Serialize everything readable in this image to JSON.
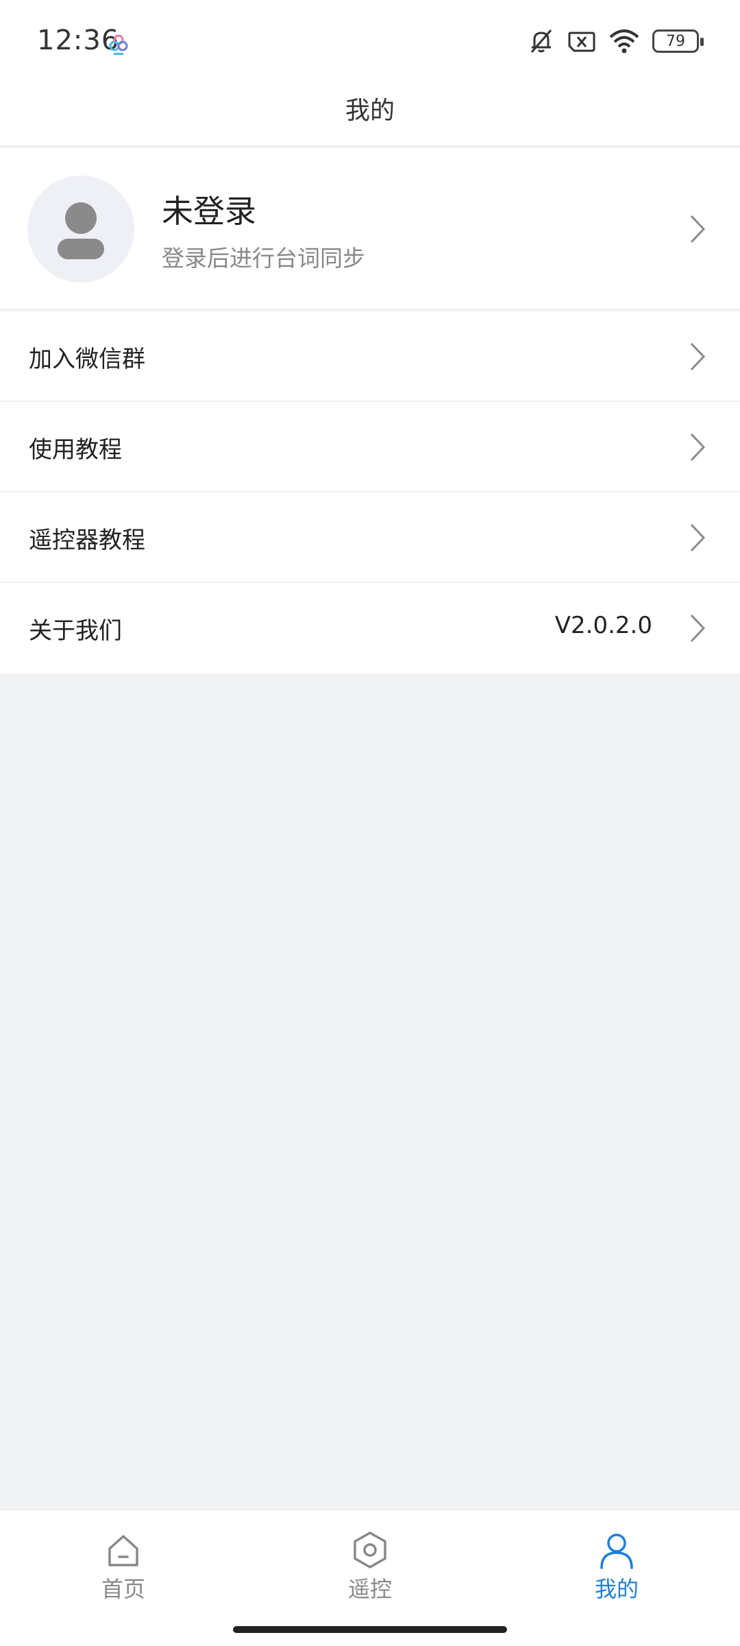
{
  "status_bar": {
    "time": "12:36",
    "battery": "79",
    "icons": [
      "app-notification-icon",
      "mute-bell-icon",
      "no-sim-icon",
      "wifi-icon",
      "battery-icon"
    ]
  },
  "header": {
    "title": "我的"
  },
  "profile": {
    "name": "未登录",
    "subtitle": "登录后进行台词同步",
    "icon": "avatar-placeholder-icon"
  },
  "menu": {
    "items": [
      {
        "label": "加入微信群",
        "value": ""
      },
      {
        "label": "使用教程",
        "value": ""
      },
      {
        "label": "遥控器教程",
        "value": ""
      },
      {
        "label": "关于我们",
        "value": "V2.0.2.0"
      }
    ]
  },
  "tabbar": {
    "items": [
      {
        "label": "首页",
        "icon": "home-icon",
        "active": false
      },
      {
        "label": "遥控",
        "icon": "remote-hexagon-icon",
        "active": false
      },
      {
        "label": "我的",
        "icon": "person-icon",
        "active": true
      }
    ],
    "active_color": "#1e7fd8",
    "inactive_color": "#888888"
  },
  "colors": {
    "background": "#f2f3f5",
    "surface": "#ffffff",
    "accent": "#1e7fd8"
  }
}
